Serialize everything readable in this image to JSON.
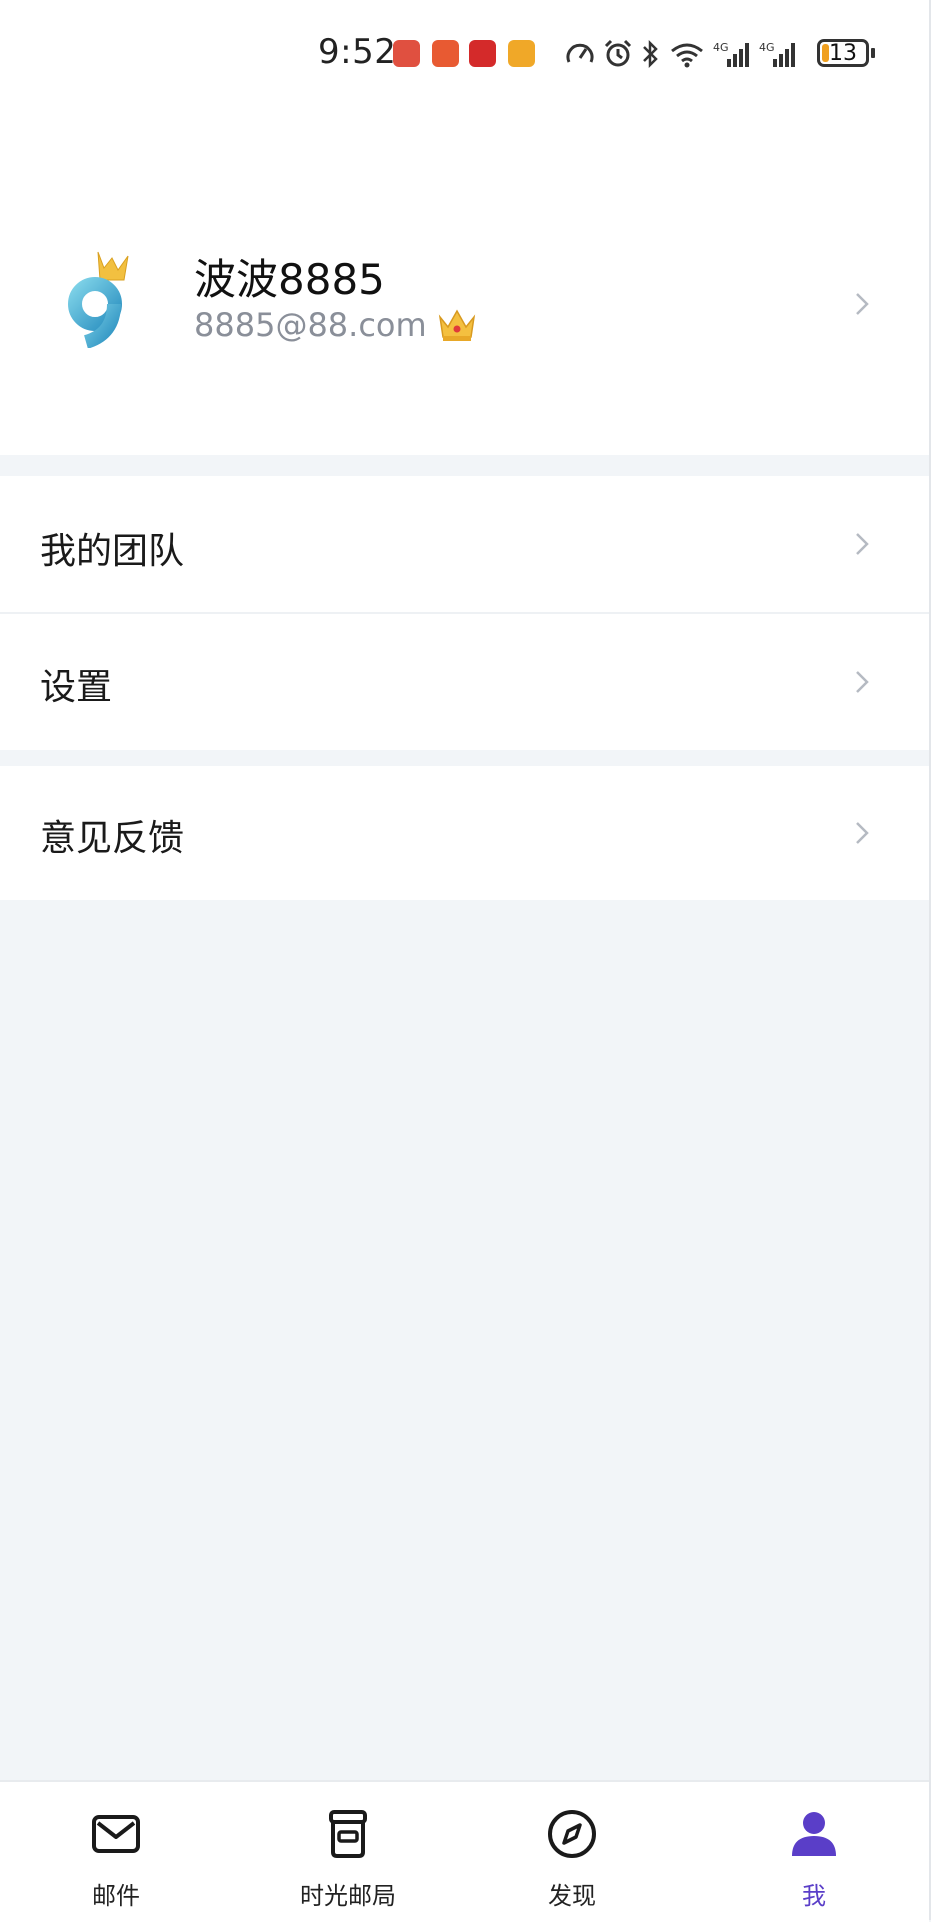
{
  "status_bar": {
    "time": "9:52",
    "battery_level": "13",
    "app_icons": [
      "huawei-app-icon",
      "orange-app-icon",
      "red-app-icon",
      "yellow-app-icon"
    ],
    "system_icons": [
      "speed-icon",
      "alarm-icon",
      "bluetooth-icon",
      "wifi-icon",
      "signal-4g-icon",
      "signal-4g-icon"
    ]
  },
  "profile": {
    "name": "波波8885",
    "email": "8885@88.com",
    "vip_badge": "crown-icon"
  },
  "menu": {
    "items": [
      {
        "label": "我的团队"
      },
      {
        "label": "设置"
      },
      {
        "label": "意见反馈"
      }
    ]
  },
  "bottom_nav": {
    "items": [
      {
        "label": "邮件",
        "icon": "mail-icon"
      },
      {
        "label": "时光邮局",
        "icon": "mailbox-icon"
      },
      {
        "label": "发现",
        "icon": "compass-icon"
      },
      {
        "label": "我",
        "icon": "user-icon",
        "active": true
      }
    ],
    "active_color": "#5a3ec8"
  }
}
